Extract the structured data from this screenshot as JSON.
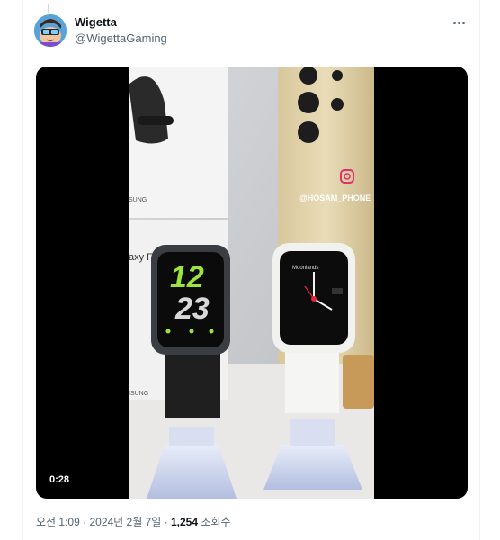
{
  "post": {
    "author_name": "Wigetta",
    "author_handle": "@WigettaGaming"
  },
  "video": {
    "duration": "0:28",
    "watermark": "@HOSAM_PHONE",
    "left_watch_time_top": "12",
    "left_watch_time_bottom": "23",
    "right_watch_brand": "Moonlands"
  },
  "meta": {
    "time": "오전 1:09",
    "separator": "·",
    "date": "2024년 2월 7일",
    "view_count": "1,254",
    "view_label": "조회수"
  },
  "colors": {
    "text_primary": "#0f1419",
    "text_secondary": "#536471",
    "watch_green": "#9be33d"
  }
}
